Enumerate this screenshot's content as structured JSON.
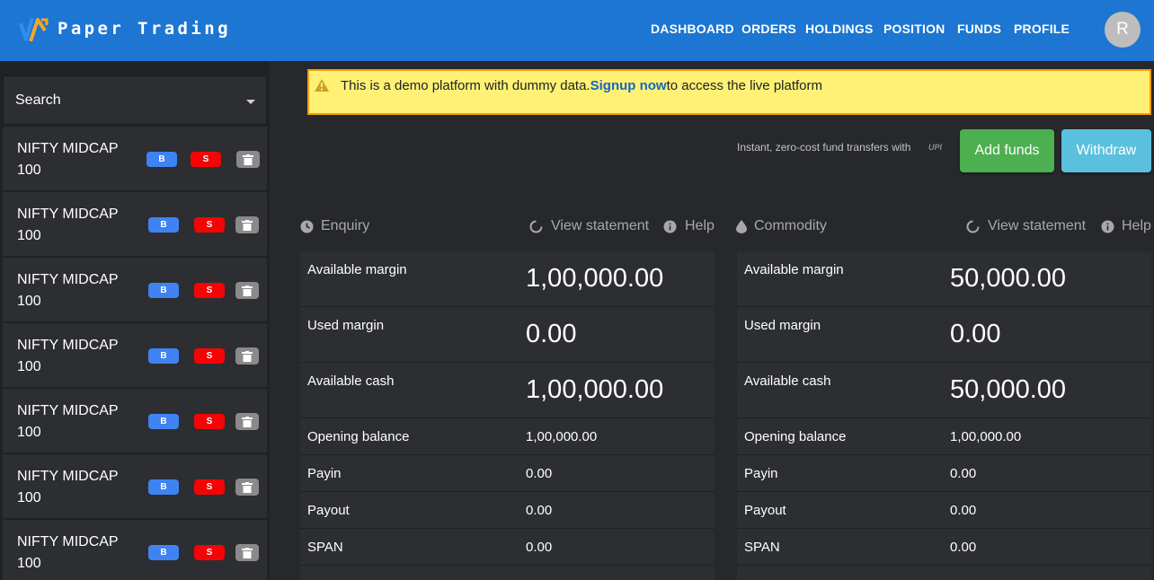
{
  "header": {
    "brand": "Paper Trading",
    "nav": [
      "DASHBOARD",
      "ORDERS",
      "HOLDINGS",
      "POSITION",
      "FUNDS",
      "PROFILE"
    ],
    "avatar": "R",
    "colors": {
      "bar": "#1c76d2"
    }
  },
  "sidebar": {
    "search": {
      "label": "Search"
    },
    "items": [
      {
        "name": "NIFTY MIDCAP 100",
        "buy": "B",
        "sell": "S"
      },
      {
        "name": "NIFTY MIDCAP 100",
        "buy": "B",
        "sell": "S"
      },
      {
        "name": "NIFTY MIDCAP 100",
        "buy": "B",
        "sell": "S"
      },
      {
        "name": "NIFTY MIDCAP 100",
        "buy": "B",
        "sell": "S"
      },
      {
        "name": "NIFTY MIDCAP 100",
        "buy": "B",
        "sell": "S"
      },
      {
        "name": "NIFTY MIDCAP 100",
        "buy": "B",
        "sell": "S"
      },
      {
        "name": "NIFTY MIDCAP 100",
        "buy": "B",
        "sell": "S"
      }
    ]
  },
  "banner": {
    "text_before": "This is a demo platform with dummy data.",
    "link": "Signup now",
    "text_after": "to access the live platform",
    "icon": "warning-icon"
  },
  "funds_actions": {
    "upi_text": "Instant, zero-cost fund transfers with",
    "upi_logo": "UPI",
    "add_funds": "Add funds",
    "withdraw": "Withdraw",
    "colors": {
      "add": "#4caf50",
      "withdraw": "#5bc0de"
    }
  },
  "equity": {
    "title": "Enquiry",
    "view_statement": "View statement",
    "help": "Help",
    "rows": [
      {
        "label": "Available margin",
        "value": "1,00,000.00"
      },
      {
        "label": "Used margin",
        "value": "0.00"
      },
      {
        "label": "Available cash",
        "value": "1,00,000.00"
      },
      {
        "label": "Opening balance",
        "value": "1,00,000.00"
      },
      {
        "label": "Payin",
        "value": "0.00"
      },
      {
        "label": "Payout",
        "value": "0.00"
      },
      {
        "label": "SPAN",
        "value": "0.00"
      }
    ]
  },
  "commodity": {
    "title": "Commodity",
    "view_statement": "View statement",
    "help": "Help",
    "rows": [
      {
        "label": "Available margin",
        "value": "50,000.00"
      },
      {
        "label": "Used margin",
        "value": "0.00"
      },
      {
        "label": "Available cash",
        "value": "50,000.00"
      },
      {
        "label": "Opening balance",
        "value": "1,00,000.00"
      },
      {
        "label": "Payin",
        "value": "0.00"
      },
      {
        "label": "Payout",
        "value": "0.00"
      },
      {
        "label": "SPAN",
        "value": "0.00"
      }
    ]
  }
}
